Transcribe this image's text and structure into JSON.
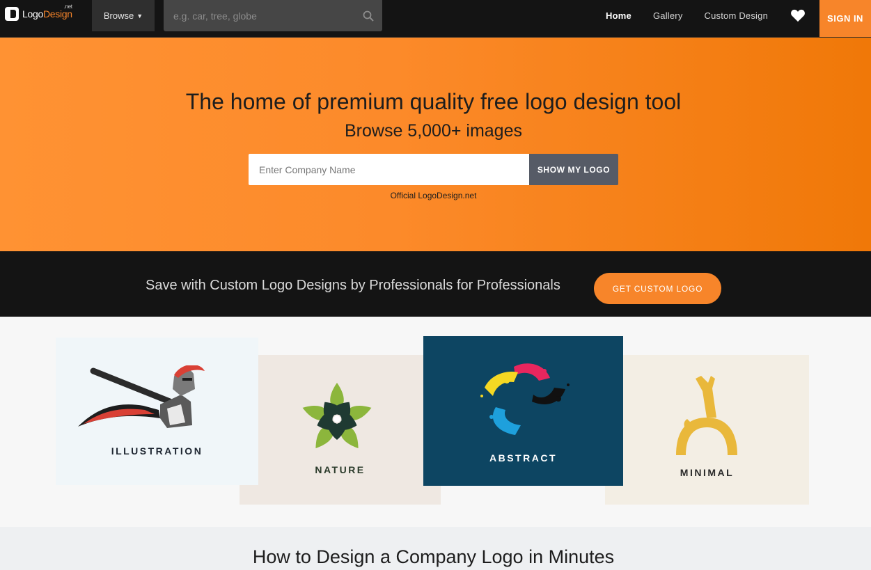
{
  "nav": {
    "brand_logo": "Logo",
    "brand_design": "Design",
    "brand_net": ".net",
    "browse_label": "Browse",
    "search_placeholder": "e.g. car, tree, globe",
    "links": [
      "Home",
      "Gallery",
      "Custom Design"
    ],
    "signin_label": "SIGN IN",
    "icons": {
      "search": "search-icon",
      "heart": "heart-icon",
      "chevron": "chevron-down-icon"
    }
  },
  "hero": {
    "title": "The home of premium quality free logo design tool",
    "subtitle": "Browse 5,000+ images",
    "input_placeholder": "Enter Company Name",
    "button_label": "SHOW MY LOGO",
    "official": "Official LogoDesign.net"
  },
  "promo": {
    "text": "Save with Custom Logo Designs by Professionals for Professionals",
    "button_label": "GET CUSTOM LOGO"
  },
  "categories": [
    {
      "label": "ILLUSTRATION",
      "bg": "#f0f6f9"
    },
    {
      "label": "NATURE",
      "bg": "#efe8e2"
    },
    {
      "label": "ABSTRACT",
      "bg": "#0d4562"
    },
    {
      "label": "MINIMAL",
      "bg": "#f3eee4"
    }
  ],
  "howto": {
    "title": "How to Design a Company Logo in Minutes"
  },
  "colors": {
    "accent": "#f7852a",
    "nav_bg": "#141414",
    "button_gray": "#565b66"
  }
}
